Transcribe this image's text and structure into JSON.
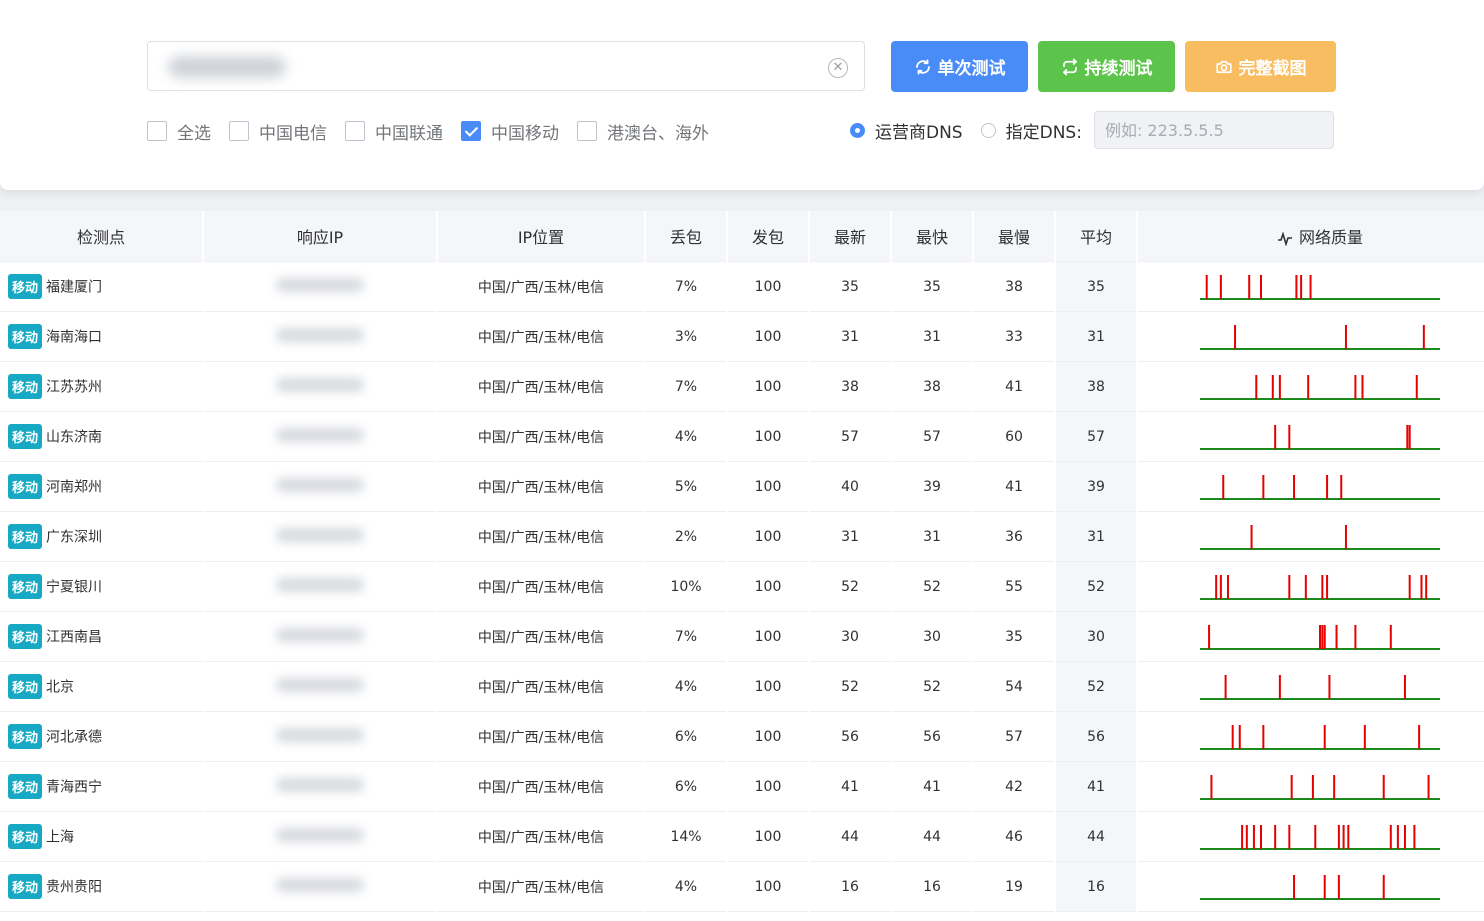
{
  "search": {
    "placeholder": ""
  },
  "buttons": {
    "single": "单次测试",
    "continuous": "持续测试",
    "screenshot": "完整截图"
  },
  "filters": [
    {
      "label": "全选",
      "checked": false
    },
    {
      "label": "中国电信",
      "checked": false
    },
    {
      "label": "中国联通",
      "checked": false
    },
    {
      "label": "中国移动",
      "checked": true
    },
    {
      "label": "港澳台、海外",
      "checked": false
    }
  ],
  "dns": {
    "operator_label": "运营商DNS",
    "custom_label": "指定DNS:",
    "custom_placeholder": "例如: 223.5.5.5",
    "selected": "operator"
  },
  "table": {
    "headers": [
      "检测点",
      "响应IP",
      "IP位置",
      "丢包",
      "发包",
      "最新",
      "最快",
      "最慢",
      "平均",
      "网络质量"
    ],
    "rows": [
      {
        "isp": "移动",
        "site": "福建厦门",
        "location": "中国/广西/玉林/电信",
        "loss": "7%",
        "sent": "100",
        "latest": "35",
        "fastest": "35",
        "slowest": "38",
        "avg": "35",
        "spikes": [
          0.02,
          0.08,
          0.2,
          0.25,
          0.4,
          0.42,
          0.46
        ]
      },
      {
        "isp": "移动",
        "site": "海南海口",
        "location": "中国/广西/玉林/电信",
        "loss": "3%",
        "sent": "100",
        "latest": "31",
        "fastest": "31",
        "slowest": "33",
        "avg": "31",
        "spikes": [
          0.14,
          0.61,
          0.94
        ]
      },
      {
        "isp": "移动",
        "site": "江苏苏州",
        "location": "中国/广西/玉林/电信",
        "loss": "7%",
        "sent": "100",
        "latest": "38",
        "fastest": "38",
        "slowest": "41",
        "avg": "38",
        "spikes": [
          0.23,
          0.3,
          0.33,
          0.45,
          0.65,
          0.68,
          0.91
        ]
      },
      {
        "isp": "移动",
        "site": "山东济南",
        "location": "中国/广西/玉林/电信",
        "loss": "4%",
        "sent": "100",
        "latest": "57",
        "fastest": "57",
        "slowest": "60",
        "avg": "57",
        "spikes": [
          0.31,
          0.37,
          0.87,
          0.88
        ]
      },
      {
        "isp": "移动",
        "site": "河南郑州",
        "location": "中国/广西/玉林/电信",
        "loss": "5%",
        "sent": "100",
        "latest": "40",
        "fastest": "39",
        "slowest": "41",
        "avg": "39",
        "spikes": [
          0.09,
          0.26,
          0.39,
          0.53,
          0.59
        ]
      },
      {
        "isp": "移动",
        "site": "广东深圳",
        "location": "中国/广西/玉林/电信",
        "loss": "2%",
        "sent": "100",
        "latest": "31",
        "fastest": "31",
        "slowest": "36",
        "avg": "31",
        "spikes": [
          0.21,
          0.61
        ]
      },
      {
        "isp": "移动",
        "site": "宁夏银川",
        "location": "中国/广西/玉林/电信",
        "loss": "10%",
        "sent": "100",
        "latest": "52",
        "fastest": "52",
        "slowest": "55",
        "avg": "52",
        "spikes": [
          0.06,
          0.08,
          0.11,
          0.37,
          0.44,
          0.51,
          0.53,
          0.88,
          0.93,
          0.95
        ]
      },
      {
        "isp": "移动",
        "site": "江西南昌",
        "location": "中国/广西/玉林/电信",
        "loss": "7%",
        "sent": "100",
        "latest": "30",
        "fastest": "30",
        "slowest": "35",
        "avg": "30",
        "spikes": [
          0.03,
          0.5,
          0.51,
          0.52,
          0.57,
          0.65,
          0.8
        ]
      },
      {
        "isp": "移动",
        "site": "北京",
        "location": "中国/广西/玉林/电信",
        "loss": "4%",
        "sent": "100",
        "latest": "52",
        "fastest": "52",
        "slowest": "54",
        "avg": "52",
        "spikes": [
          0.1,
          0.33,
          0.54,
          0.86
        ]
      },
      {
        "isp": "移动",
        "site": "河北承德",
        "location": "中国/广西/玉林/电信",
        "loss": "6%",
        "sent": "100",
        "latest": "56",
        "fastest": "56",
        "slowest": "57",
        "avg": "56",
        "spikes": [
          0.13,
          0.16,
          0.26,
          0.52,
          0.69,
          0.92
        ]
      },
      {
        "isp": "移动",
        "site": "青海西宁",
        "location": "中国/广西/玉林/电信",
        "loss": "6%",
        "sent": "100",
        "latest": "41",
        "fastest": "41",
        "slowest": "42",
        "avg": "41",
        "spikes": [
          0.04,
          0.38,
          0.47,
          0.56,
          0.77,
          0.96
        ]
      },
      {
        "isp": "移动",
        "site": "上海",
        "location": "中国/广西/玉林/电信",
        "loss": "14%",
        "sent": "100",
        "latest": "44",
        "fastest": "44",
        "slowest": "46",
        "avg": "44",
        "spikes": [
          0.17,
          0.19,
          0.22,
          0.25,
          0.31,
          0.37,
          0.48,
          0.58,
          0.6,
          0.62,
          0.8,
          0.83,
          0.86,
          0.9
        ]
      },
      {
        "isp": "移动",
        "site": "贵州贵阳",
        "location": "中国/广西/玉林/电信",
        "loss": "4%",
        "sent": "100",
        "latest": "16",
        "fastest": "16",
        "slowest": "19",
        "avg": "16",
        "spikes": [
          0.39,
          0.52,
          0.58,
          0.77
        ]
      }
    ]
  },
  "colors": {
    "primary": "#4a8cf7",
    "success": "#5cc44a",
    "warning": "#f8bd60",
    "tag": "#17a9c3",
    "spike": "#e60000",
    "baseline": "#1a8a1a"
  }
}
